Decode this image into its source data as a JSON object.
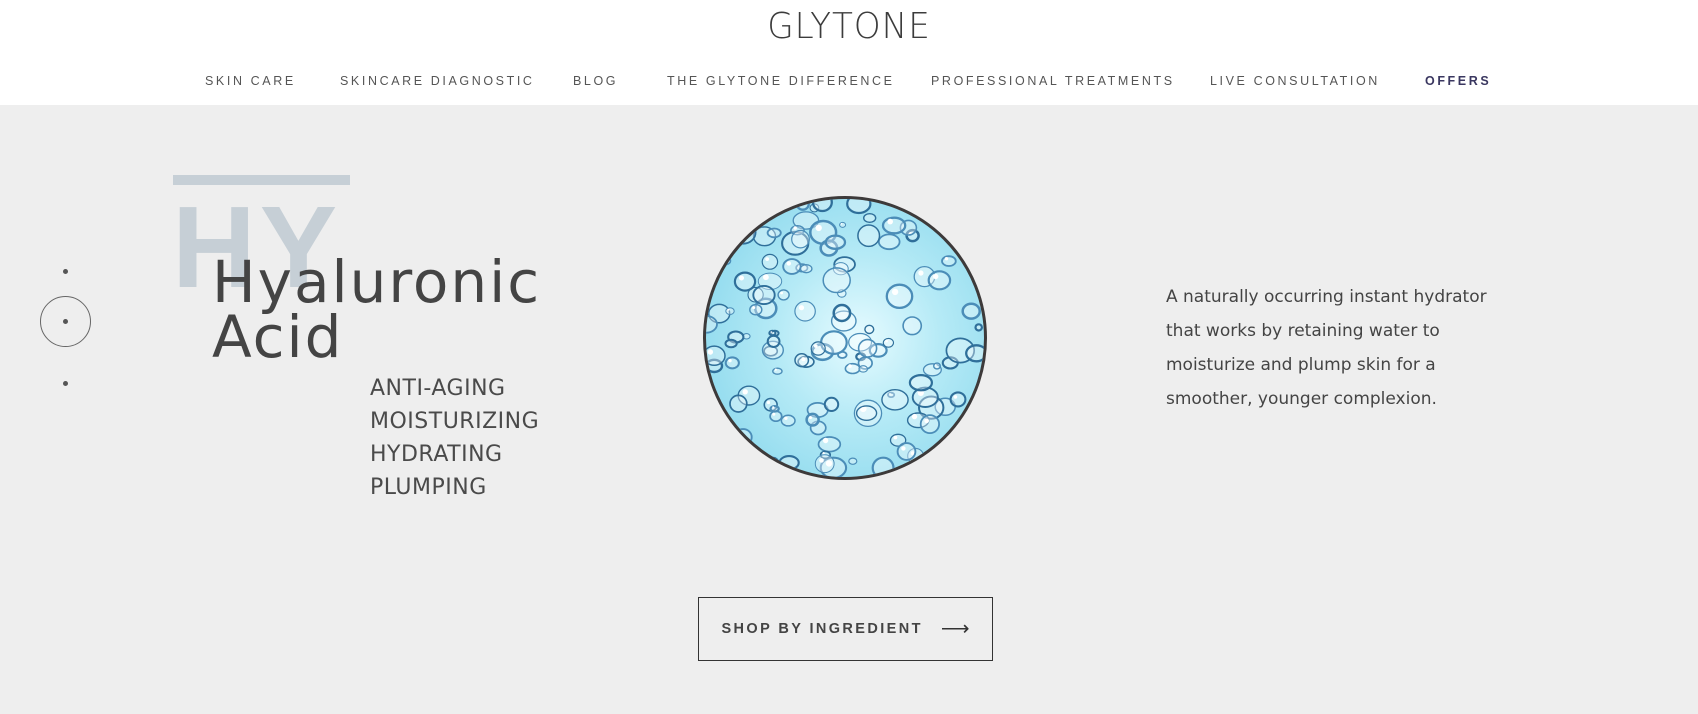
{
  "brand": {
    "logo_text": "GLYTONE"
  },
  "nav": {
    "items": [
      "SKIN CARE",
      "SKINCARE DIAGNOSTIC",
      "BLOG",
      "THE GLYTONE DIFFERENCE",
      "PROFESSIONAL TREATMENTS",
      "LIVE CONSULTATION",
      "OFFERS"
    ],
    "active_accent": "#3a3760"
  },
  "hero": {
    "background_letters": "HY",
    "title_line1": "Hyaluronic",
    "title_line2": "Acid",
    "benefits": [
      "ANTI-AGING",
      "MOISTURIZING",
      "HYDRATING",
      "PLUMPING"
    ],
    "image_icon": "water-bubbles-image",
    "description": "A naturally occurring instant hydrator that works by retaining water to moisturize and plump skin for a smoother, younger complexion.",
    "cta_label": "SHOP BY INGREDIENT",
    "cta_icon": "arrow-right-icon",
    "accent_color": "#c6cfd6",
    "background_color": "#eeeeee"
  },
  "pager": {
    "count": 3,
    "active_index": 1
  }
}
